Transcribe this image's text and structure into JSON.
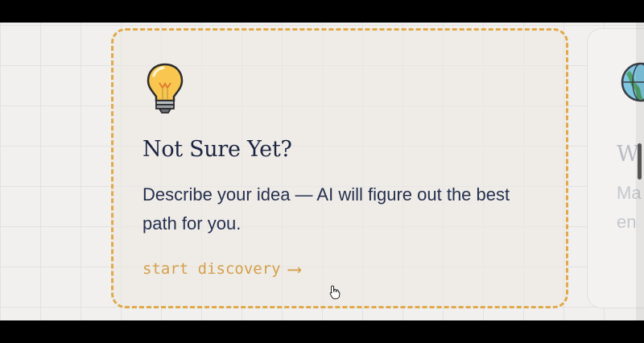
{
  "main_card": {
    "icon": "lightbulb-icon",
    "title": "Not Sure Yet?",
    "description": "Describe your idea — AI will figure out the best path for you.",
    "link_label": "start discovery",
    "link_arrow": "⟶",
    "accent_color": "#e0a94a"
  },
  "next_card": {
    "icon": "globe-icon",
    "title_fragment": "W",
    "description_lines": [
      "Ma",
      "en"
    ]
  }
}
